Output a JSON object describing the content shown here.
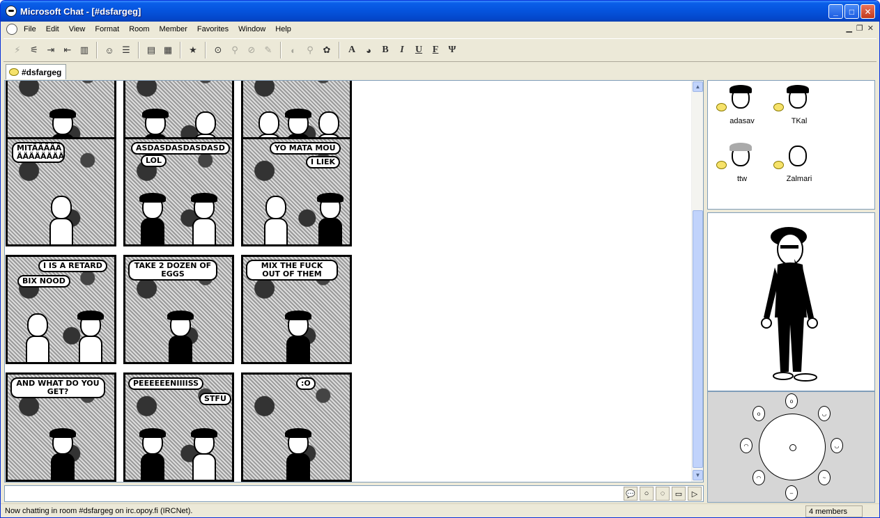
{
  "window": {
    "title": "Microsoft Chat - [#dsfargeg]"
  },
  "menu": [
    "File",
    "Edit",
    "View",
    "Format",
    "Room",
    "Member",
    "Favorites",
    "Window",
    "Help"
  ],
  "tab": {
    "label": "#dsfargeg"
  },
  "toolbar": {
    "format_icons": [
      "A",
      "B",
      "I",
      "U",
      "F",
      "Ψ"
    ]
  },
  "comic": {
    "rows": [
      [
        {
          "texts": []
        },
        {
          "texts": []
        },
        {
          "texts": []
        }
      ],
      [
        {
          "texts": [
            "MITÄÄÄÄÄ ÄÄÄÄÄÄÄÄ"
          ]
        },
        {
          "texts": [
            "ASDASDASDASDASD",
            "LOL"
          ]
        },
        {
          "texts": [
            "YO MATA MOU",
            "I LIEK"
          ]
        }
      ],
      [
        {
          "texts": [
            "I IS A RETARD",
            "BIX NOOD"
          ]
        },
        {
          "texts": [
            "TAKE 2 DOZEN OF EGGS"
          ]
        },
        {
          "texts": [
            "MIX THE FUCK OUT OF THEM"
          ]
        }
      ],
      [
        {
          "texts": [
            "AND WHAT DO YOU GET?"
          ]
        },
        {
          "texts": [
            "PEEEEEENIIIISS",
            "STFU"
          ]
        },
        {
          "texts": [
            ":O"
          ]
        }
      ]
    ]
  },
  "members": [
    {
      "name": "adasav"
    },
    {
      "name": "TKal"
    },
    {
      "name": "ttw"
    },
    {
      "name": "Zalmari"
    }
  ],
  "input": {
    "value": ""
  },
  "status": {
    "text": "Now chatting in room #dsfargeg on irc.opoy.fi (IRCNet).",
    "members": "4 members"
  },
  "colors": {
    "titlebar": "#0553dc",
    "chrome": "#ece9d8",
    "bubble": "#f6e26a"
  }
}
